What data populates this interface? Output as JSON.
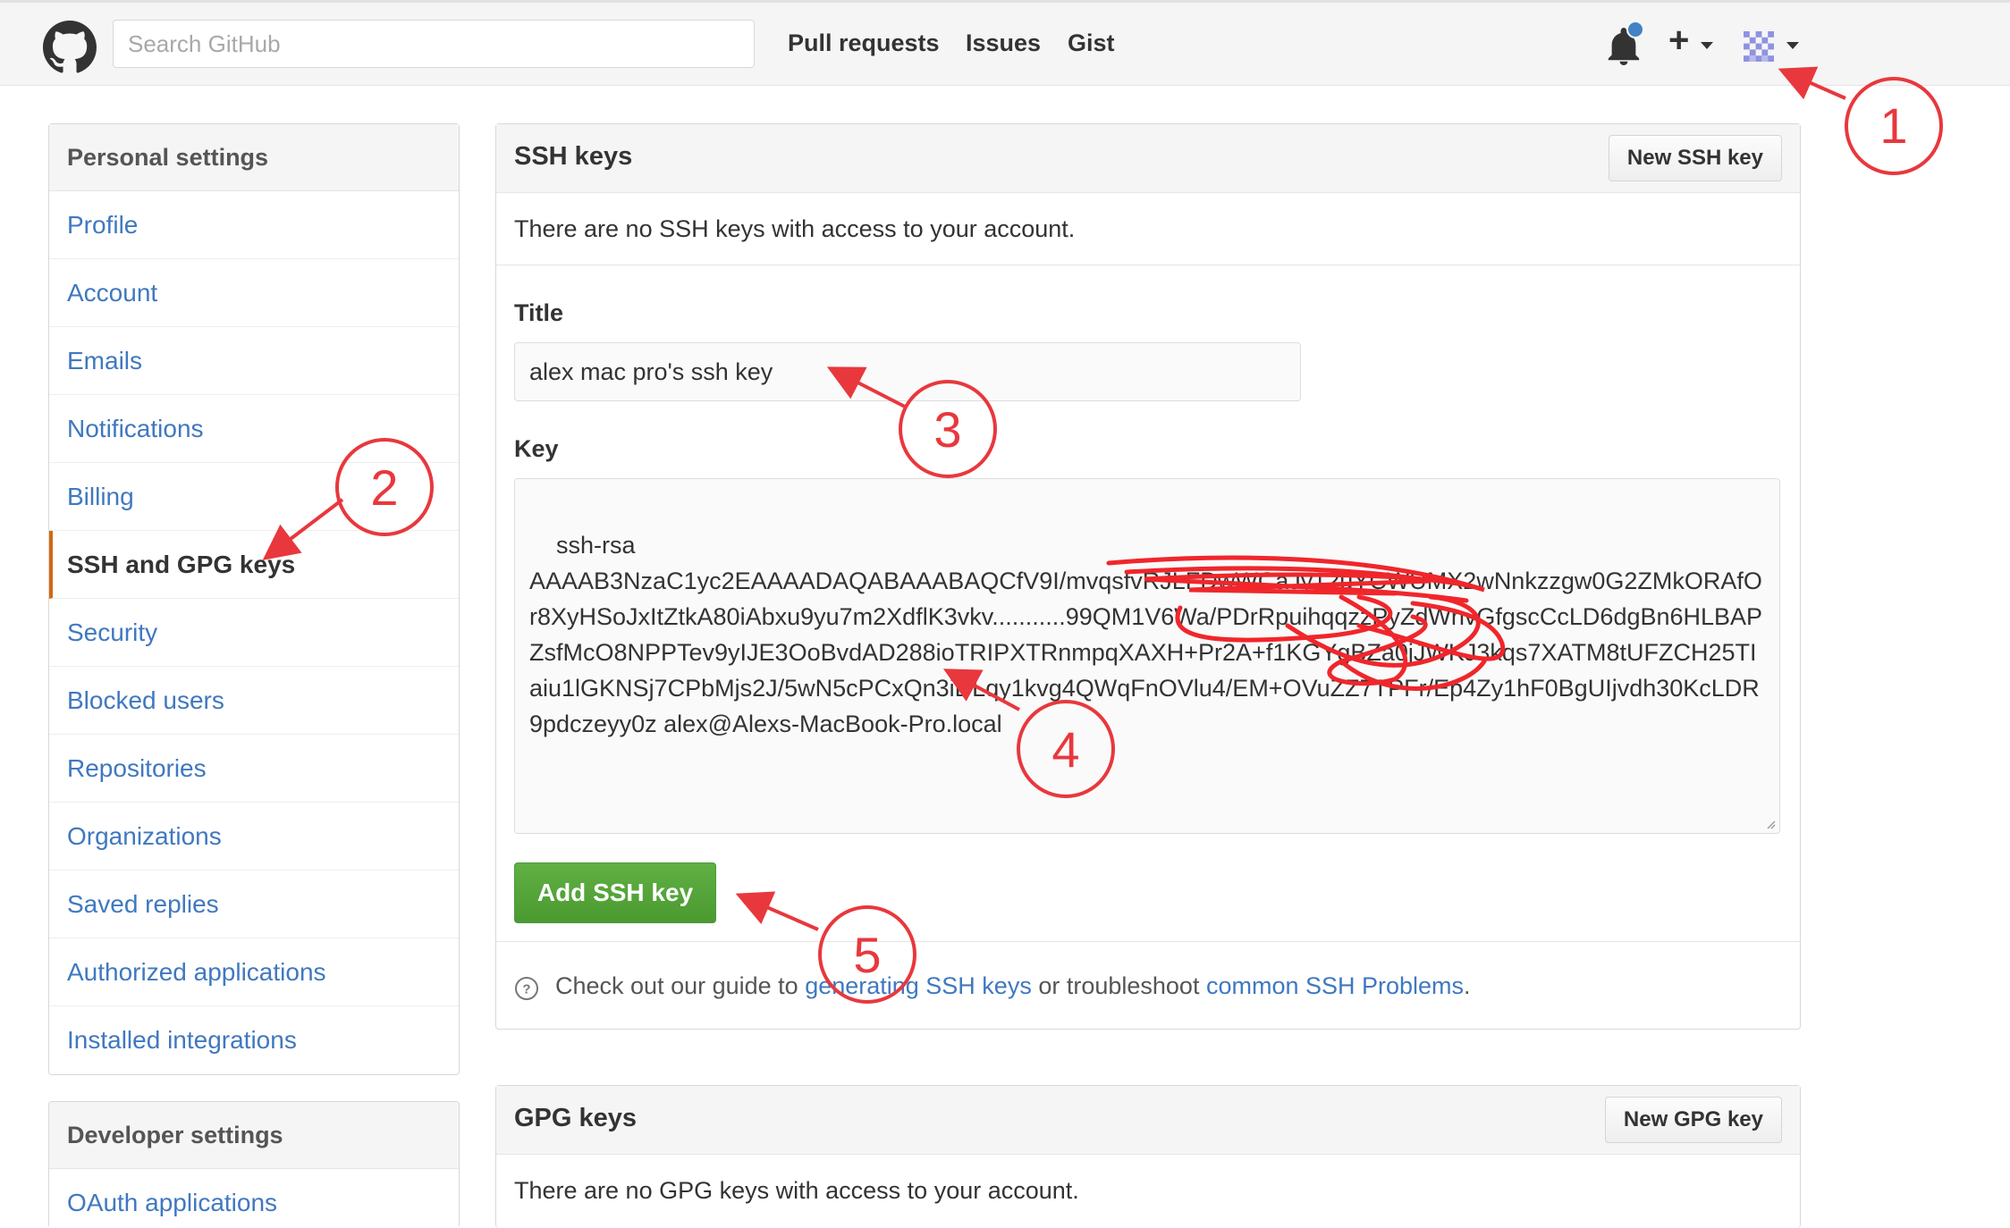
{
  "header": {
    "search_placeholder": "Search GitHub",
    "nav": [
      "Pull requests",
      "Issues",
      "Gist"
    ],
    "plus": "+"
  },
  "sidebar": {
    "personal_heading": "Personal settings",
    "items": [
      {
        "label": "Profile"
      },
      {
        "label": "Account"
      },
      {
        "label": "Emails"
      },
      {
        "label": "Notifications"
      },
      {
        "label": "Billing"
      },
      {
        "label": "SSH and GPG keys",
        "selected": true
      },
      {
        "label": "Security"
      },
      {
        "label": "Blocked users"
      },
      {
        "label": "Repositories"
      },
      {
        "label": "Organizations"
      },
      {
        "label": "Saved replies"
      },
      {
        "label": "Authorized applications"
      },
      {
        "label": "Installed integrations"
      }
    ],
    "developer_heading": "Developer settings",
    "developer_items": [
      {
        "label": "OAuth applications"
      }
    ]
  },
  "ssh": {
    "title": "SSH keys",
    "new_button": "New SSH key",
    "empty_text": "There are no SSH keys with access to your account.",
    "title_label": "Title",
    "title_value": "alex mac pro's ssh key",
    "key_label": "Key",
    "key_value": "ssh-rsa\nAAAAB3NzaC1yc2EAAAADAQABAAABAQCfV9I/mvqsfvRJLFDwWCaJy12uYCWUMX2wNnkzzgw0G2ZMkORAfOr8XyHSoJxItZtkA80iAbxu9yu7m2XdflK3vkv...........99QM1V6Wa/PDrRpuihqqzzPyZdWnvGfgscCcLD6dgBn6HLBAPZsfMcO8NPPTev9yIJE3OoBvdAD288ioTRIPXTRnmpqXAXH+Pr2A+f1KGYgBZa0jJWKJ3kqs7XATM8tUFZCH25TIaiu1lGKNSj7CPbMjs2J/5wN5cPCxQn3iDLqy1kvg4QWqFnOVlu4/EM+OVuZZ7TPFr/Ep4Zy1hF0BgUIjvdh30KcLDR9pdczeyy0z alex@Alexs-MacBook-Pro.local",
    "add_button": "Add SSH key",
    "help_prefix": "Check out our guide to ",
    "help_link1": "generating SSH keys",
    "help_middle": " or troubleshoot ",
    "help_link2": "common SSH Problems",
    "help_suffix": "."
  },
  "gpg": {
    "title": "GPG keys",
    "new_button": "New GPG key",
    "empty_text": "There are no GPG keys with access to your account."
  },
  "annotations": [
    "1",
    "2",
    "3",
    "4",
    "5"
  ],
  "colors": {
    "link": "#4078c0",
    "selected_border": "#d26911",
    "green_button": "#55a532",
    "annotation_red": "#e8383d",
    "notification_dot": "#4183c4"
  }
}
